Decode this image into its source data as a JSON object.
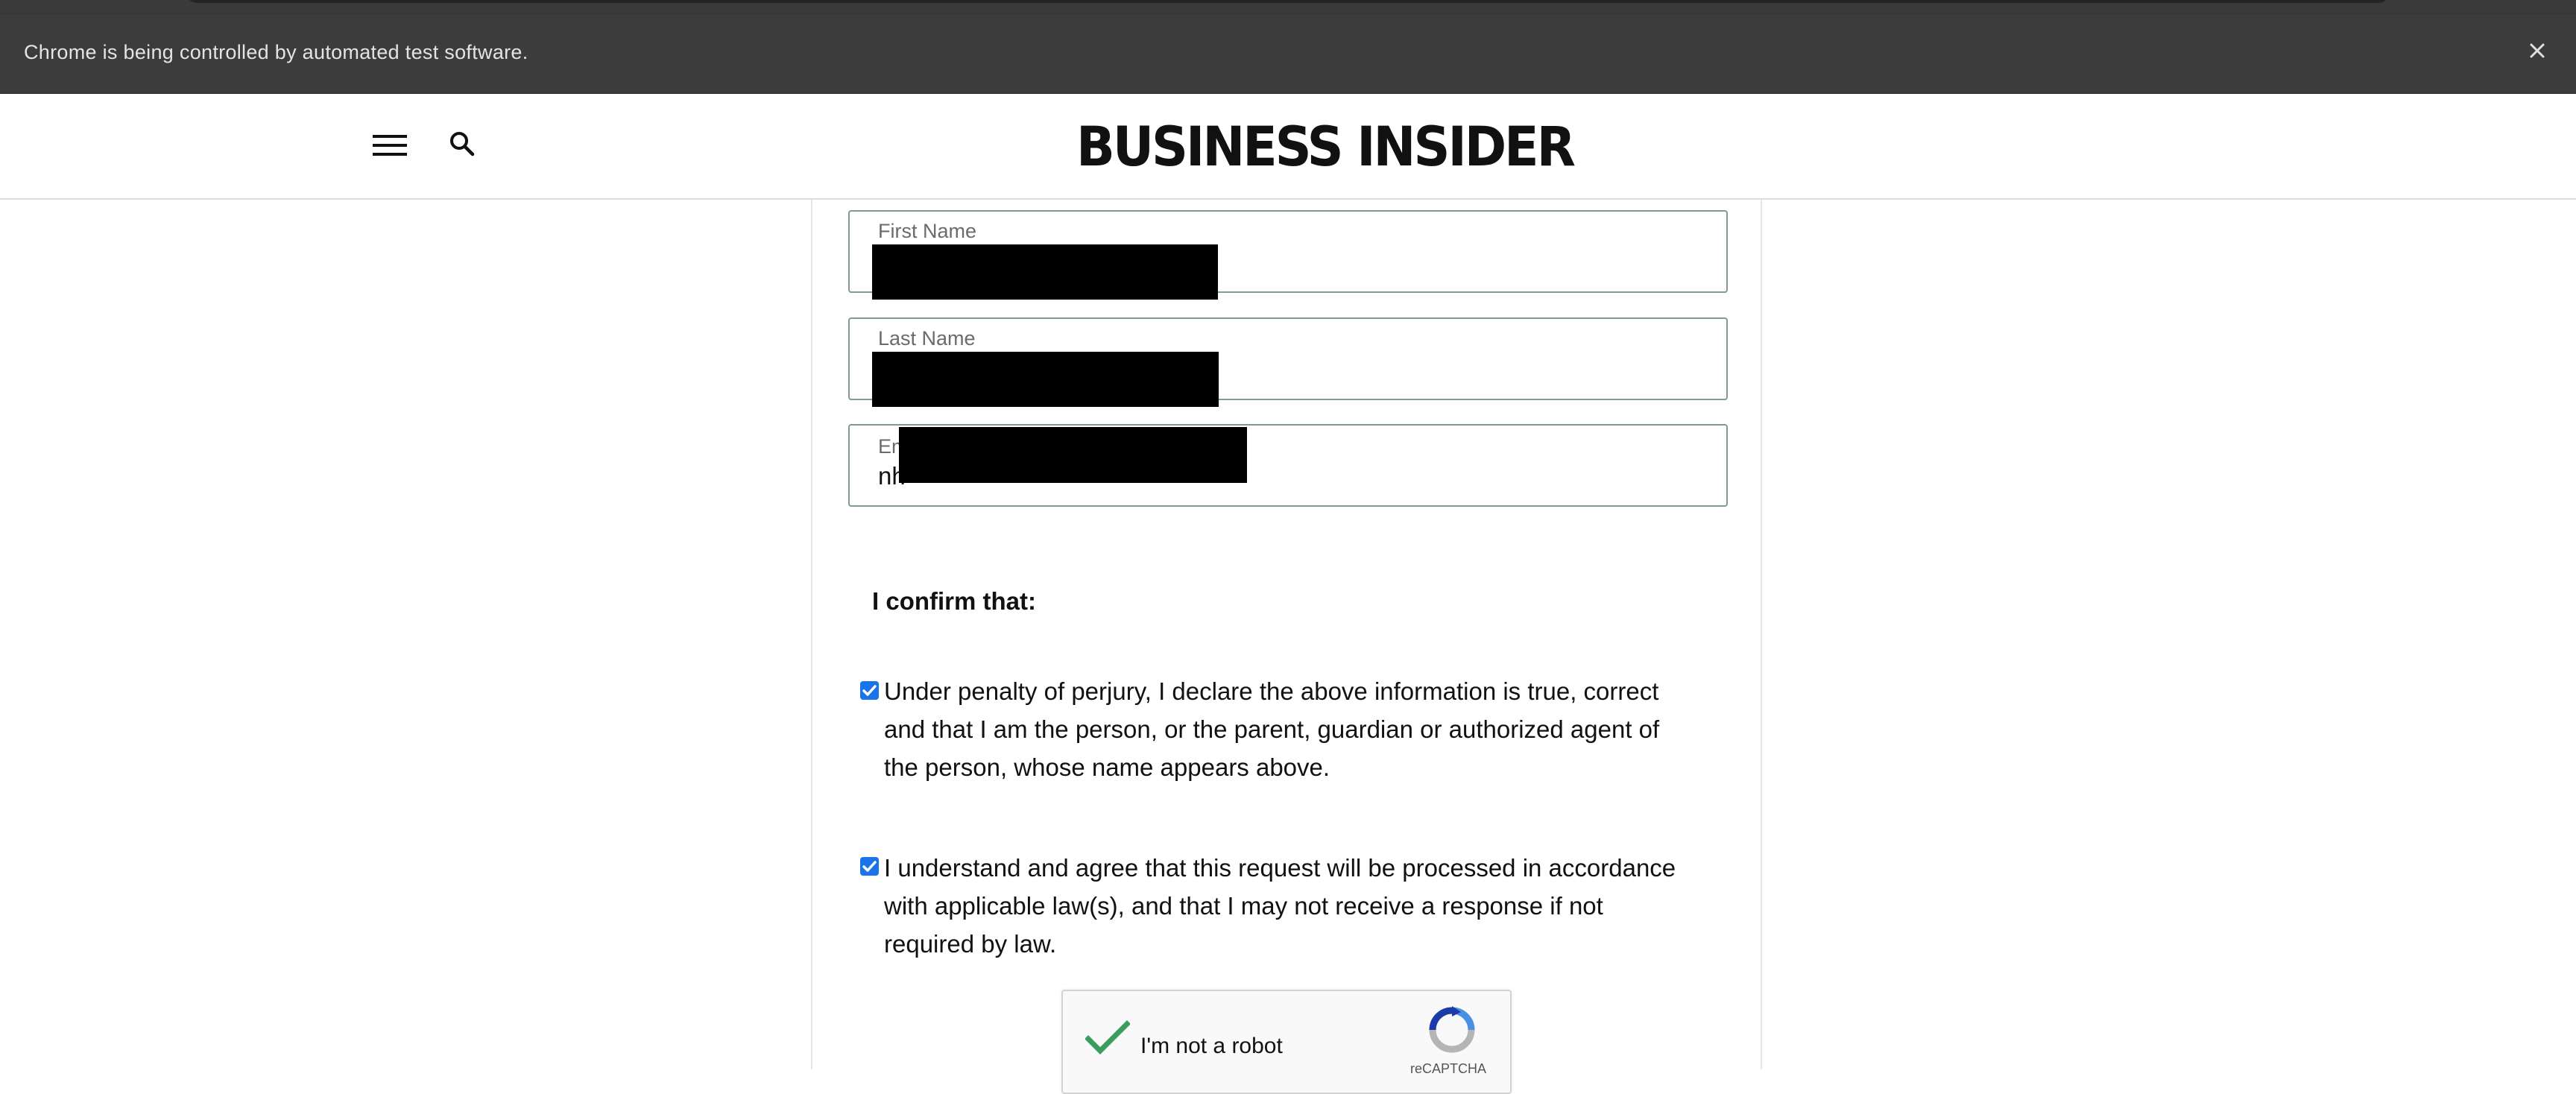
{
  "browser": {
    "infobar_text": "Chrome is being controlled by automated test software.",
    "close_icon": "close-icon"
  },
  "header": {
    "menu_icon": "hamburger-menu-icon",
    "search_icon": "search-icon",
    "logo_text": "BUSINESS INSIDER"
  },
  "form": {
    "first_name": {
      "label": "First Name",
      "value": ""
    },
    "last_name": {
      "label": "Last Name",
      "value": ""
    },
    "email": {
      "label_visible": "Em",
      "value_visible": "nh"
    },
    "confirm_heading": "I confirm that:",
    "checkboxes": [
      {
        "checked": true,
        "text": "Under penalty of perjury, I declare the above information is true, correct and that I am the person, or the parent, guardian or authorized agent of the person, whose name appears above."
      },
      {
        "checked": true,
        "text": "I understand and agree that this request will be processed in accordance with applicable law(s), and that I may not receive a response if not required by law."
      }
    ],
    "recaptcha": {
      "checked": true,
      "label": "I'm not a robot",
      "brand": "reCAPTCHA"
    }
  },
  "colors": {
    "infobar_bg": "#3c3c3c",
    "field_border": "#7d9b94",
    "checkbox_blue": "#1a73e8",
    "recaptcha_green": "#3b9d5d"
  }
}
